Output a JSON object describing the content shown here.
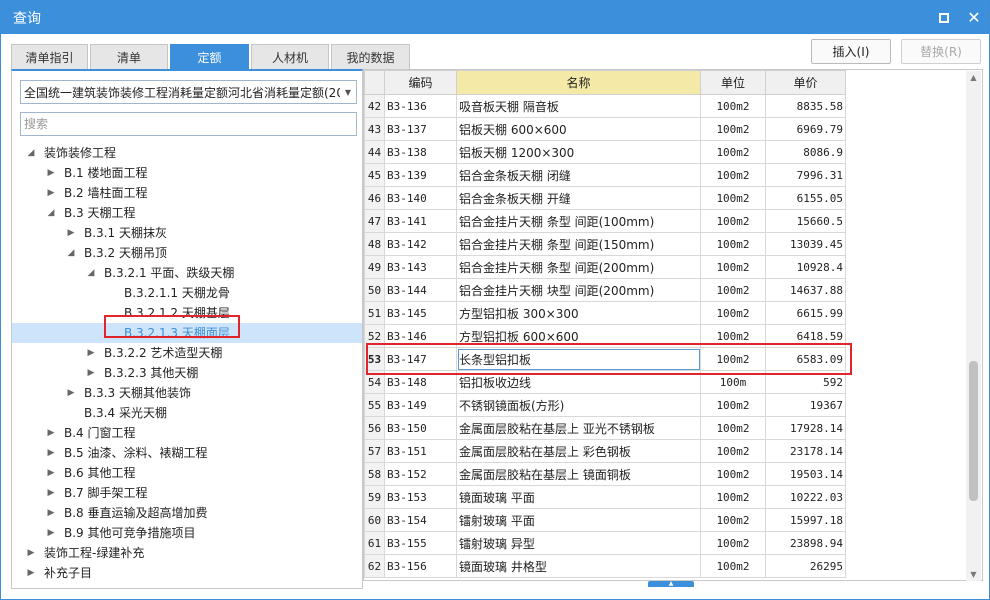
{
  "window": {
    "title": "查询"
  },
  "tabs": [
    {
      "label": "清单指引"
    },
    {
      "label": "清单"
    },
    {
      "label": "定额"
    },
    {
      "label": "人材机"
    },
    {
      "label": "我的数据"
    }
  ],
  "buttons": {
    "insert": "插入(I)",
    "replace": "替换(R)"
  },
  "left": {
    "combo_value": "全国统一建筑装饰装修工程消耗量定额河北省消耗量定额(20",
    "search_placeholder": "搜索"
  },
  "tree": [
    {
      "label": "装饰装修工程",
      "level": 0,
      "state": "expanded"
    },
    {
      "label": "B.1 楼地面工程",
      "level": 1,
      "state": "collapsed"
    },
    {
      "label": "B.2 墙柱面工程",
      "level": 1,
      "state": "collapsed"
    },
    {
      "label": "B.3 天棚工程",
      "level": 1,
      "state": "expanded"
    },
    {
      "label": "B.3.1 天棚抹灰",
      "level": 2,
      "state": "collapsed"
    },
    {
      "label": "B.3.2 天棚吊顶",
      "level": 2,
      "state": "expanded"
    },
    {
      "label": "B.3.2.1 平面、跌级天棚",
      "level": 3,
      "state": "expanded"
    },
    {
      "label": "B.3.2.1.1 天棚龙骨",
      "level": 4,
      "state": "leaf"
    },
    {
      "label": "B.3.2.1.2 天棚基层",
      "level": 4,
      "state": "leaf"
    },
    {
      "label": "B.3.2.1.3 天棚面层",
      "level": 4,
      "state": "leaf",
      "selected": true
    },
    {
      "label": "B.3.2.2 艺术造型天棚",
      "level": 3,
      "state": "collapsed"
    },
    {
      "label": "B.3.2.3 其他天棚",
      "level": 3,
      "state": "collapsed"
    },
    {
      "label": "B.3.3 天棚其他装饰",
      "level": 2,
      "state": "collapsed"
    },
    {
      "label": "B.3.4 采光天棚",
      "level": 2,
      "state": "leaf"
    },
    {
      "label": "B.4 门窗工程",
      "level": 1,
      "state": "collapsed"
    },
    {
      "label": "B.5 油漆、涂料、裱糊工程",
      "level": 1,
      "state": "collapsed"
    },
    {
      "label": "B.6 其他工程",
      "level": 1,
      "state": "collapsed"
    },
    {
      "label": "B.7 脚手架工程",
      "level": 1,
      "state": "collapsed"
    },
    {
      "label": "B.8 垂直运输及超高增加费",
      "level": 1,
      "state": "collapsed"
    },
    {
      "label": "B.9 其他可竞争措施项目",
      "level": 1,
      "state": "collapsed"
    },
    {
      "label": "装饰工程-绿建补充",
      "level": 0,
      "state": "collapsed"
    },
    {
      "label": "补充子目",
      "level": 0,
      "state": "collapsed"
    }
  ],
  "table": {
    "headers": {
      "code": "编码",
      "name": "名称",
      "unit": "单位",
      "price": "单价"
    },
    "rows": [
      {
        "n": "42",
        "code": "B3-136",
        "name": "吸音板天棚 隔音板",
        "unit": "100m2",
        "price": "8835.58"
      },
      {
        "n": "43",
        "code": "B3-137",
        "name": "铝板天棚 600×600",
        "unit": "100m2",
        "price": "6969.79"
      },
      {
        "n": "44",
        "code": "B3-138",
        "name": "铝板天棚 1200×300",
        "unit": "100m2",
        "price": "8086.9"
      },
      {
        "n": "45",
        "code": "B3-139",
        "name": "铝合金条板天棚 闭缝",
        "unit": "100m2",
        "price": "7996.31"
      },
      {
        "n": "46",
        "code": "B3-140",
        "name": "铝合金条板天棚 开缝",
        "unit": "100m2",
        "price": "6155.05"
      },
      {
        "n": "47",
        "code": "B3-141",
        "name": "铝合金挂片天棚 条型 间距(100mm)",
        "unit": "100m2",
        "price": "15660.5"
      },
      {
        "n": "48",
        "code": "B3-142",
        "name": "铝合金挂片天棚 条型 间距(150mm)",
        "unit": "100m2",
        "price": "13039.45"
      },
      {
        "n": "49",
        "code": "B3-143",
        "name": "铝合金挂片天棚 条型 间距(200mm)",
        "unit": "100m2",
        "price": "10928.4"
      },
      {
        "n": "50",
        "code": "B3-144",
        "name": "铝合金挂片天棚 块型 间距(200mm)",
        "unit": "100m2",
        "price": "14637.88"
      },
      {
        "n": "51",
        "code": "B3-145",
        "name": "方型铝扣板 300×300",
        "unit": "100m2",
        "price": "6615.99"
      },
      {
        "n": "52",
        "code": "B3-146",
        "name": "方型铝扣板 600×600",
        "unit": "100m2",
        "price": "6418.59"
      },
      {
        "n": "53",
        "code": "B3-147",
        "name": "长条型铝扣板",
        "unit": "100m2",
        "price": "6583.09",
        "current": true
      },
      {
        "n": "54",
        "code": "B3-148",
        "name": "铝扣板收边线",
        "unit": "100m",
        "price": "592"
      },
      {
        "n": "55",
        "code": "B3-149",
        "name": "不锈钢镜面板(方形)",
        "unit": "100m2",
        "price": "19367"
      },
      {
        "n": "56",
        "code": "B3-150",
        "name": "金属面层胶粘在基层上 亚光不锈钢板",
        "unit": "100m2",
        "price": "17928.14"
      },
      {
        "n": "57",
        "code": "B3-151",
        "name": "金属面层胶粘在基层上 彩色钢板",
        "unit": "100m2",
        "price": "23178.14"
      },
      {
        "n": "58",
        "code": "B3-152",
        "name": "金属面层胶粘在基层上 镜面铜板",
        "unit": "100m2",
        "price": "19503.14"
      },
      {
        "n": "59",
        "code": "B3-153",
        "name": "镜面玻璃 平面",
        "unit": "100m2",
        "price": "10222.03"
      },
      {
        "n": "60",
        "code": "B3-154",
        "name": "镭射玻璃 平面",
        "unit": "100m2",
        "price": "15997.18"
      },
      {
        "n": "61",
        "code": "B3-155",
        "name": "镭射玻璃 异型",
        "unit": "100m2",
        "price": "23898.94"
      },
      {
        "n": "62",
        "code": "B3-156",
        "name": "镜面玻璃 井格型",
        "unit": "100m2",
        "price": "26295"
      }
    ]
  },
  "colors": {
    "accent": "#3c8fdb",
    "highlight_box": "#e0262c",
    "name_header": "#f5e9a8"
  }
}
